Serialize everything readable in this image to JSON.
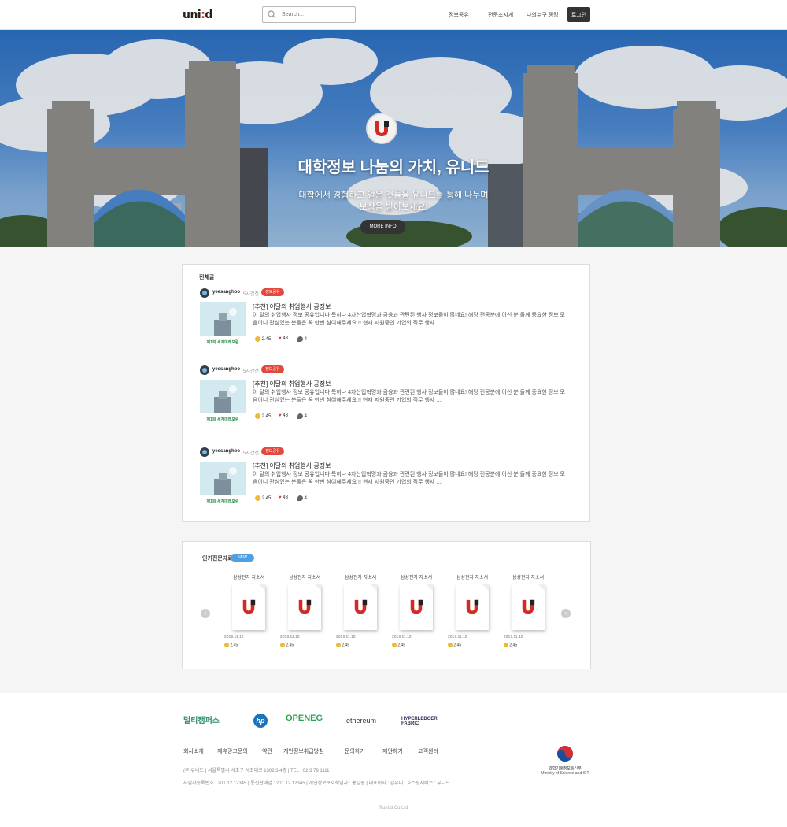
{
  "header": {
    "logo": {
      "pre": "uni",
      "mid": ":",
      "post": "d"
    },
    "search_placeholder": "Search...",
    "nav": [
      "정보공유",
      "전문조지게",
      "나의누구 랭킹"
    ],
    "login": "로그인"
  },
  "hero": {
    "title": "대학정보 나눔의 가치, 유니드",
    "sub_line1": "대학에서 경험하고 얻은 것들을 유니드를 통해 나누며",
    "sub_line2": "보상을 받아보세요!",
    "more": "MORE INFO"
  },
  "feed": {
    "title": "전체글",
    "posts": [
      {
        "author": "yeesanghoo",
        "time": "5시간전",
        "tag": "정보공유",
        "title": "[추천] 이달의 취업행사 공정보",
        "body": "이 달의 취업행사 정보 공유입니다 특히나 4차산업혁명과 금융과 관련된 행사 정보들이 많네요! 해당 전공분에 이신 분 들께 중요한 정보 모음이니 관심있는 분들은 꼭 한번 참여해주세요 !! 현재 지원중인 기업의 직무 행사 ....",
        "points": "2.45",
        "likes": "43",
        "comments": "4",
        "thumb_caption": "제1회 세계미래포럼"
      },
      {
        "author": "yeesanghoo",
        "time": "5시간전",
        "tag": "정보공유",
        "title": "[추천] 이달의 취업행사 공정보",
        "body": "이 달의 취업행사 정보 공유입니다 특히나 4차산업혁명과 금융과 관련된 행사 정보들이 많네요! 해당 전공분에 이신 분 들께 중요한 정보 모음이니 관심있는 분들은 꼭 한번 참여해주세요 !! 현재 지원중인 기업의 직무 행사 ....",
        "points": "2.45",
        "likes": "43",
        "comments": "4",
        "thumb_caption": "제1회 세계미래포럼"
      },
      {
        "author": "yeesanghoo",
        "time": "5시간전",
        "tag": "정보공유",
        "title": "[추천] 이달의 취업행사 공정보",
        "body": "이 달의 취업행사 정보 공유입니다 특히나 4차산업혁명과 금융과 관련된 행사 정보들이 많네요! 해당 전공분에 이신 분 들께 중요한 정보 모음이니 관심있는 분들은 꼭 한번 참여해주세요 !! 현재 지원중인 기업의 직무 행사 ....",
        "points": "2.45",
        "likes": "43",
        "comments": "4",
        "thumb_caption": "제1회 세계미래포럼"
      }
    ]
  },
  "popular": {
    "title": "인기전문자료",
    "badge": "NEW",
    "docs": [
      {
        "title": "삼성전자 자소서",
        "date": "2019.11.12",
        "points": "2.45"
      },
      {
        "title": "삼성전자 자소서",
        "date": "2019.11.12",
        "points": "2.45"
      },
      {
        "title": "삼성전자 자소서",
        "date": "2019.11.12",
        "points": "2.45"
      },
      {
        "title": "삼성전자 자소서",
        "date": "2019.11.12",
        "points": "2.45"
      },
      {
        "title": "삼성전자 자소서",
        "date": "2019.11.12",
        "points": "2.45"
      },
      {
        "title": "삼성전자 자소서",
        "date": "2019.11.12",
        "points": "2.45"
      }
    ],
    "prev": "‹",
    "next": "›"
  },
  "footer": {
    "partners": [
      "멀티캠퍼스",
      "hp",
      "OPENEG",
      "ethereum",
      "HYPERLEDGER FABRIC"
    ],
    "links": [
      "회사소개",
      "제휴광고문의",
      "약관",
      "개인정보취급방침",
      "문의하기",
      "제안하기",
      "고객센터"
    ],
    "info_line1": "(주)유니드   |   서울특별시 서초구 서초대로 1302 3 4층   |   TEL : 02 3 79 1111",
    "info_line2": "사업자등록번호 : 201 12 12345   |   통신판매업 : 201 12 12345   |   개인정보보호책임자 : 홍길동   |   대표이사 : 김유니   |   호스팅서비스 : 유니드",
    "ministry_name": "과학기술정보통신부",
    "ministry_en": "Ministry of Science and ICT",
    "copyright": "©uni:d Co.Ltd"
  },
  "colors": {
    "accent_red": "#e4483c",
    "badge_blue": "#4f9fe2",
    "dark": "#333333"
  }
}
